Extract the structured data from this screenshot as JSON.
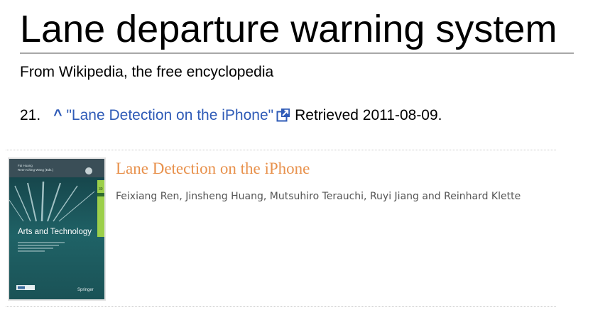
{
  "article": {
    "title": "Lane departure warning system",
    "tagline": "From Wikipedia, the free encyclopedia"
  },
  "reference": {
    "number": "21.",
    "caret": "^",
    "link_text": "\"Lane Detection on the iPhone\"",
    "external_icon": "external-link-icon",
    "retrieved": "Retrieved 2011-08-09."
  },
  "book": {
    "title": "Lane Detection on the iPhone",
    "authors": "Feixiang Ren, Jinsheng Huang, Mutsuhiro Terauchi, Ruyi Jiang and Reinhard Klette",
    "cover": {
      "editors_line1": "Fai Huang",
      "editors_line2": "Reen-Ching Wang (Eds.)",
      "series_title": "Arts and Technology",
      "publisher": "Springer"
    }
  },
  "colors": {
    "link": "#2f5bb7",
    "book_title": "#e8914c",
    "authors": "#555555",
    "cover_bg": "#1f5f63"
  }
}
